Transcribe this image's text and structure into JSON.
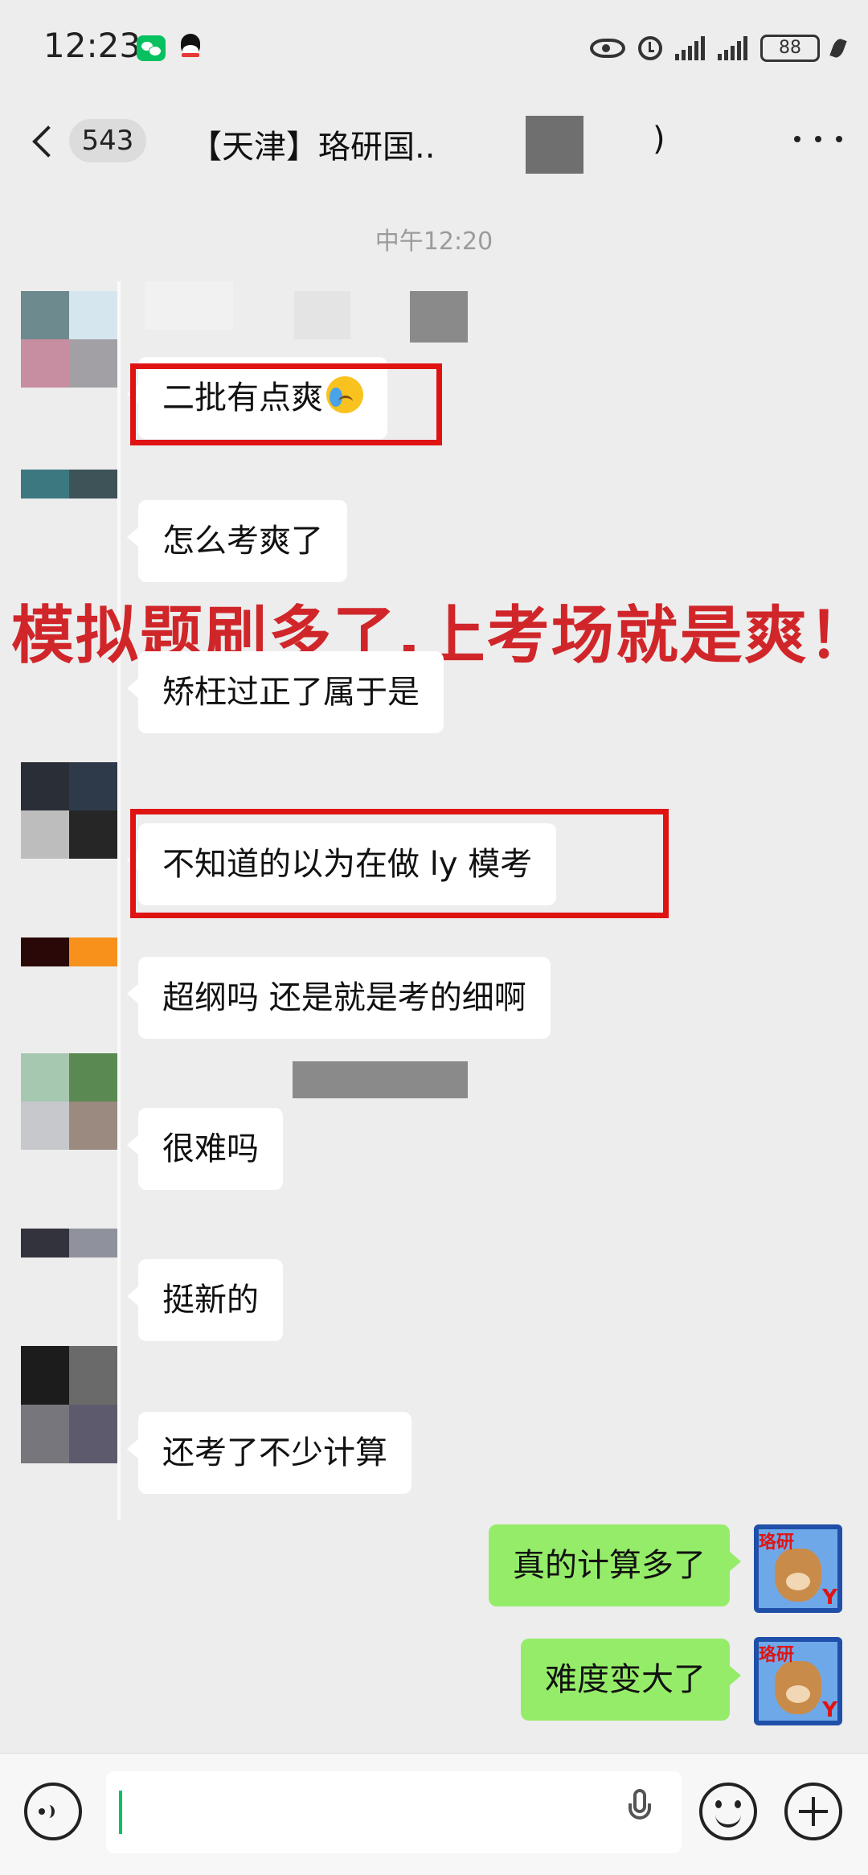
{
  "status_bar": {
    "time": "12:23",
    "battery": "88",
    "icons": [
      "wechat-notification-icon",
      "qq-notification-icon",
      "eye-icon",
      "alarm-icon",
      "signal-icon",
      "signal-icon",
      "battery-icon",
      "leaf-icon"
    ]
  },
  "nav": {
    "unread_count": "543",
    "title": "【天津】珞研国..",
    "title_suffix": ")",
    "icons": [
      "back-icon",
      "more-icon"
    ]
  },
  "chat": {
    "timestamp": "中午12:20",
    "overlay_caption": "模拟题刷多了,上考场就是爽！",
    "messages": [
      {
        "side": "left",
        "text": "二批有点爽",
        "emoji": "crying-laughing-emoji"
      },
      {
        "side": "left",
        "text": "怎么考爽了"
      },
      {
        "side": "left",
        "text": "矫枉过正了属于是"
      },
      {
        "side": "left",
        "text": "不知道的以为在做 ly 模考"
      },
      {
        "side": "left",
        "text": "超纲吗 还是就是考的细啊"
      },
      {
        "side": "left",
        "text": "很难吗"
      },
      {
        "side": "left",
        "text": "挺新的"
      },
      {
        "side": "left",
        "text": "还考了不少计算"
      },
      {
        "side": "right",
        "text": "真的计算多了"
      },
      {
        "side": "right",
        "text": "难度变大了"
      }
    ],
    "my_avatar": {
      "tag": "珞研",
      "logo": "Y"
    },
    "colors": {
      "highlight": "#e01313",
      "caption": "#d0262a",
      "my_bubble": "#95ec69",
      "other_bubble": "#ffffff",
      "background": "#ededed"
    }
  },
  "input": {
    "value": "",
    "icons": [
      "voice-icon",
      "mic-icon",
      "emoji-icon",
      "plus-icon"
    ]
  }
}
